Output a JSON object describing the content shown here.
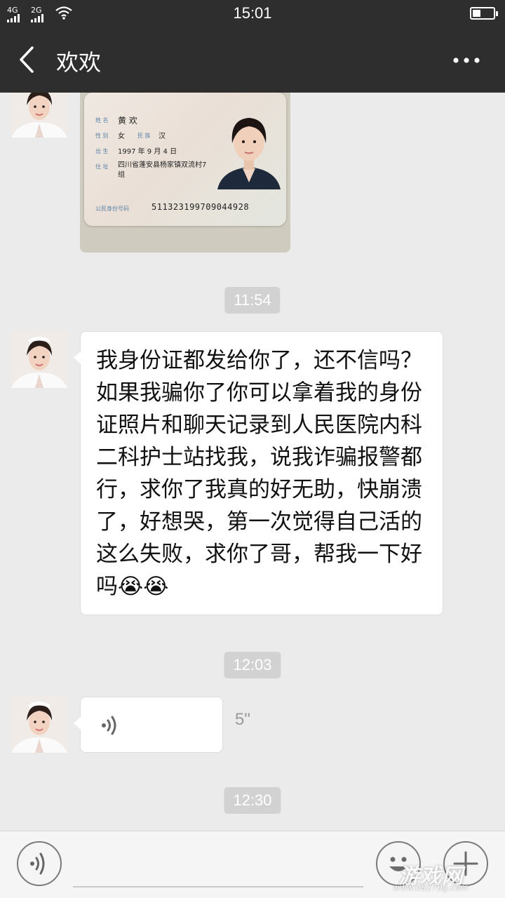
{
  "status_bar": {
    "network_1": "4G",
    "network_2": "2G",
    "time": "15:01",
    "battery_level": 0.4
  },
  "header": {
    "title": "欢欢",
    "back_icon": "chevron-left-icon",
    "more_icon": "more-horizontal-icon"
  },
  "id_card": {
    "name_label": "姓 名",
    "name": "黄 欢",
    "gender_label": "性 别",
    "gender": "女",
    "ethnicity_label": "民 族",
    "ethnicity": "汉",
    "birth_label": "出 生",
    "birth": "1997 年 9 月 4 日",
    "address_label": "住 址",
    "address": "四川省蓬安县杨家镇双流村7组",
    "number_label": "公民身份号码",
    "number": "511323199709044928"
  },
  "messages": {
    "timestamp_1": "11:54",
    "text_message": "我身份证都发给你了，还不信吗？如果我骗你了你可以拿着我的身份证照片和聊天记录到人民医院内科二科护士站找我，说我诈骗报警都行，求你了我真的好无助，快崩溃了，好想哭，第一次觉得自己活的这么失败，求你了哥，帮我一下好吗😭😭",
    "timestamp_2": "12:03",
    "voice_duration": "5\"",
    "timestamp_3": "12:30"
  },
  "input_bar": {
    "voice_icon": "voice-input-icon",
    "emoji_icon": "emoji-icon",
    "plus_icon": "plus-icon"
  },
  "watermark": {
    "text": "游戏网",
    "url": "www.0827bg.com"
  }
}
